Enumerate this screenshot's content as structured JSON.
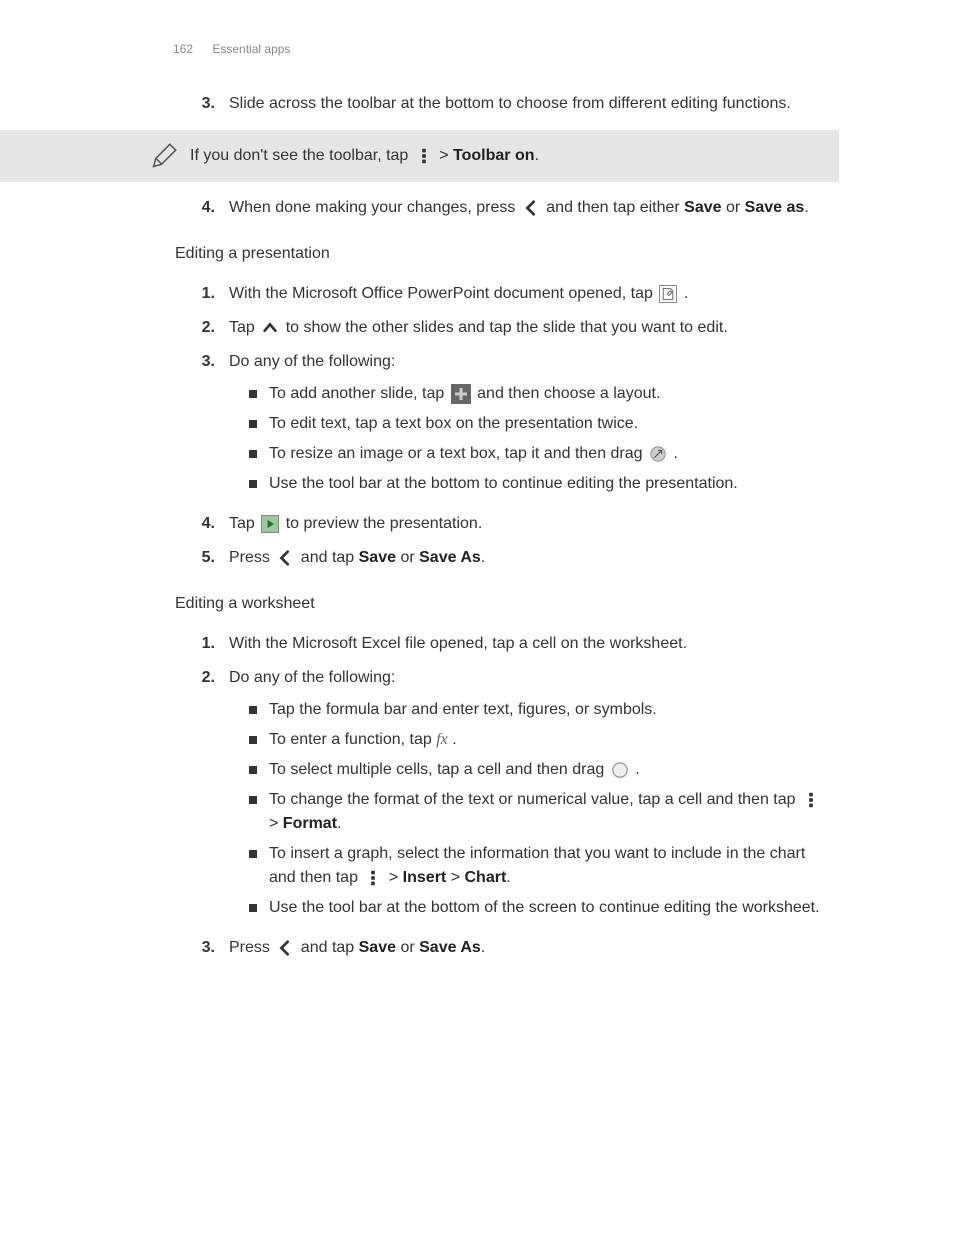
{
  "header": {
    "page_number": "162",
    "section": "Essential apps"
  },
  "top_steps": {
    "s3": {
      "num": "3.",
      "text": "Slide across the toolbar at the bottom to choose from different editing functions."
    }
  },
  "tip": {
    "pre": "If you don't see the toolbar, tap ",
    "post1": " > ",
    "bold": "Toolbar on",
    "post2": "."
  },
  "top_steps2": {
    "s4": {
      "num": "4.",
      "pre": "When done making your changes, press ",
      "mid": " and then tap either ",
      "b1": "Save",
      "or": " or ",
      "b2": "Save as",
      "end": "."
    }
  },
  "pres": {
    "heading": "Editing a presentation",
    "s1": {
      "num": "1.",
      "pre": "With the Microsoft Office PowerPoint document opened, tap ",
      "end": "."
    },
    "s2": {
      "num": "2.",
      "pre": "Tap ",
      "post": " to show the other slides and tap the slide that you want to edit."
    },
    "s3": {
      "num": "3.",
      "text": "Do any of the following:"
    },
    "s3a": {
      "pre": "To add another slide, tap ",
      "post": " and then choose a layout."
    },
    "s3b": "To edit text, tap a text box on the presentation twice.",
    "s3c": {
      "pre": "To resize an image or a text box, tap it and then drag ",
      "post": "."
    },
    "s3d": "Use the tool bar at the bottom to continue editing the presentation.",
    "s4": {
      "num": "4.",
      "pre": "Tap ",
      "post": " to preview the presentation."
    },
    "s5": {
      "num": "5.",
      "pre": "Press ",
      "mid": " and tap ",
      "b1": "Save",
      "or": " or ",
      "b2": "Save As",
      "end": "."
    }
  },
  "ws": {
    "heading": "Editing a worksheet",
    "s1": {
      "num": "1.",
      "text": "With the Microsoft Excel file opened, tap a cell on the worksheet."
    },
    "s2": {
      "num": "2.",
      "text": "Do any of the following:"
    },
    "s2a": "Tap the formula bar and enter text, figures, or symbols.",
    "s2b": {
      "pre": "To enter a function, tap ",
      "fx": "fx",
      "post": " ."
    },
    "s2c": {
      "pre": "To select multiple cells, tap a cell and then drag ",
      "post": "."
    },
    "s2d": {
      "pre": "To change the format of the text or numerical value, tap a cell and then tap ",
      "mid": " > ",
      "b": "Format",
      "post": "."
    },
    "s2e": {
      "pre": "To insert a graph, select the information that you want to include in the chart and then tap ",
      "m1": " > ",
      "b1": "Insert",
      "m2": " > ",
      "b2": "Chart",
      "post": "."
    },
    "s2f": "Use the tool bar at the bottom of the screen to continue editing the worksheet.",
    "s3": {
      "num": "3.",
      "pre": "Press ",
      "mid": " and tap ",
      "b1": "Save",
      "or": " or ",
      "b2": "Save As",
      "end": "."
    }
  }
}
